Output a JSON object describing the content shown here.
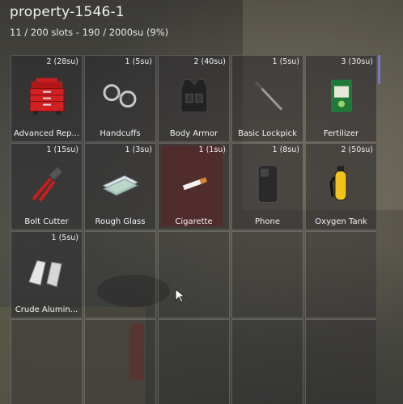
{
  "header": {
    "title": "property-1546-1",
    "capacity": "11 / 200 slots - 190 / 2000su (9%)"
  },
  "colors": {
    "scrollbar": "#7c78c8",
    "slot_border": "#9a9a9a"
  },
  "items": [
    {
      "meta": "2 (28su)",
      "label": "Advanced Rep...",
      "icon": "toolbox-icon"
    },
    {
      "meta": "1 (5su)",
      "label": "Handcuffs",
      "icon": "handcuffs-icon"
    },
    {
      "meta": "2 (40su)",
      "label": "Body Armor",
      "icon": "body-armor-icon"
    },
    {
      "meta": "1 (5su)",
      "label": "Basic Lockpick",
      "icon": "lockpick-icon"
    },
    {
      "meta": "3 (30su)",
      "label": "Fertilizer",
      "icon": "fertilizer-bag-icon"
    },
    {
      "meta": "1 (15su)",
      "label": "Bolt Cutter",
      "icon": "bolt-cutter-icon"
    },
    {
      "meta": "1 (3su)",
      "label": "Rough Glass",
      "icon": "glass-sheets-icon"
    },
    {
      "meta": "1 (1su)",
      "label": "Cigarette",
      "icon": "cigarette-icon"
    },
    {
      "meta": "1 (8su)",
      "label": "Phone",
      "icon": "phone-icon"
    },
    {
      "meta": "2 (50su)",
      "label": "Oxygen Tank",
      "icon": "oxygen-tank-icon"
    },
    {
      "meta": "1 (5su)",
      "label": "Crude Alumin...",
      "icon": "aluminum-chunks-icon"
    }
  ]
}
